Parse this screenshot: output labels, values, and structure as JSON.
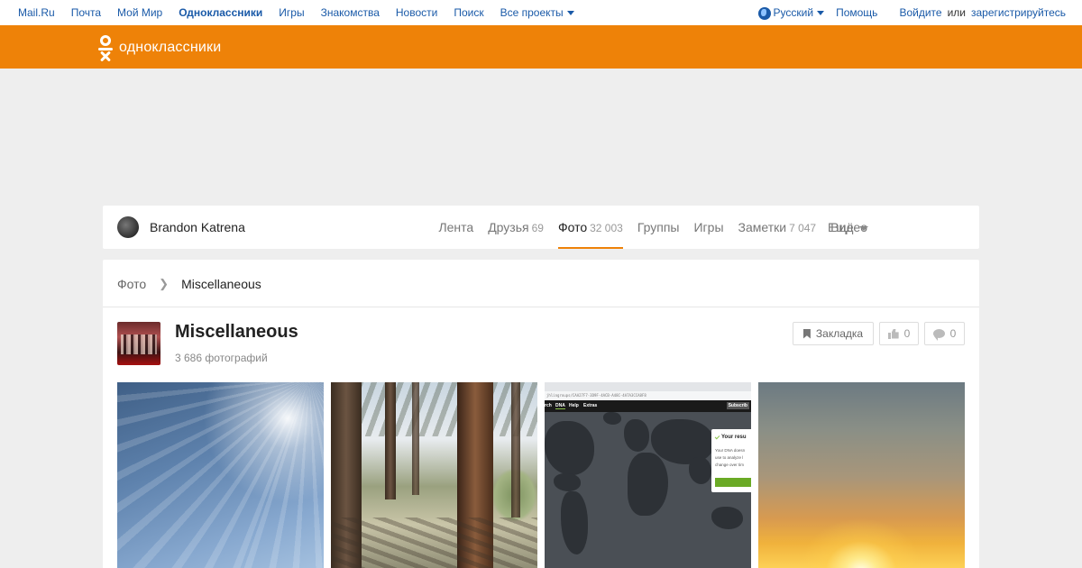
{
  "portal": {
    "links": [
      "Mail.Ru",
      "Почта",
      "Мой Мир",
      "Одноклассники",
      "Игры",
      "Знакомства",
      "Новости",
      "Поиск",
      "Все проекты"
    ],
    "language": "Русский",
    "help": "Помощь",
    "login": "Войдите",
    "or": "или",
    "register": "зарегистрируйтесь"
  },
  "header": {
    "logo_text": "одноклассники",
    "brand_color": "#ee8208"
  },
  "profile": {
    "name": "Brandon Katrena",
    "tabs": [
      {
        "label": "Лента",
        "count": ""
      },
      {
        "label": "Друзья",
        "count": "69"
      },
      {
        "label": "Фото",
        "count": "32 003",
        "active": true
      },
      {
        "label": "Группы",
        "count": ""
      },
      {
        "label": "Игры",
        "count": ""
      },
      {
        "label": "Заметки",
        "count": "7 047"
      },
      {
        "label": "Видео",
        "count": ""
      }
    ],
    "more_label": "Ещё"
  },
  "breadcrumb": {
    "root": "Фото",
    "current": "Miscellaneous"
  },
  "album": {
    "title": "Miscellaneous",
    "photo_count": "3 686 фотографий",
    "bookmark_label": "Закладка",
    "likes": "0",
    "comments": "0"
  },
  "screenshot_photo": {
    "nav_items": [
      "DNA",
      "Help",
      "Extras"
    ],
    "nav_prefix": "rch",
    "subscribe": "Subscrib",
    "popup_title": "Your resu",
    "popup_lines": [
      "Your DNA doesn",
      "use to analyze l",
      "change over tim"
    ]
  }
}
